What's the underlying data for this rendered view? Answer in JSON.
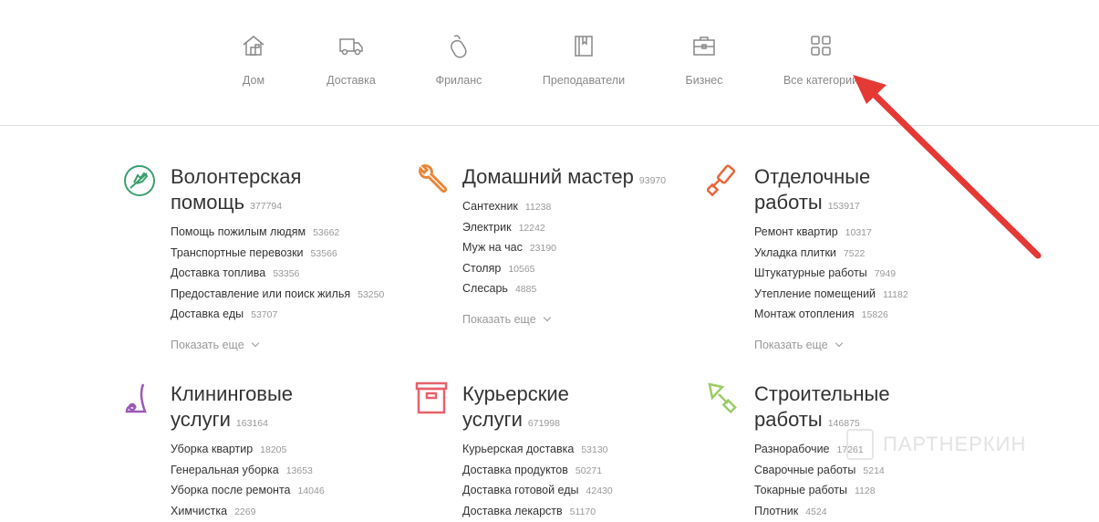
{
  "nav": [
    {
      "label": "Дом",
      "icon": "house-icon"
    },
    {
      "label": "Доставка",
      "icon": "truck-icon"
    },
    {
      "label": "Фриланс",
      "icon": "mouse-icon"
    },
    {
      "label": "Преподаватели",
      "icon": "book-icon"
    },
    {
      "label": "Бизнес",
      "icon": "briefcase-icon"
    },
    {
      "label": "Все категории",
      "icon": "grid-icon"
    }
  ],
  "more_label": "Показать еще",
  "watermark": "ПАРТНЕРКИН",
  "colors": {
    "green": "#3a9f6e",
    "orange": "#e8863a",
    "orange2": "#e8663a",
    "purple": "#9b59b6",
    "red": "#e8606a",
    "lime": "#9ccc65",
    "arrow": "#e53935"
  },
  "categories": [
    {
      "title1": "Волонтерская",
      "title2": "помощь",
      "count": "377794",
      "items": [
        [
          "Помощь пожилым людям",
          "53662"
        ],
        [
          "Транспортные перевозки",
          "53566"
        ],
        [
          "Доставка топлива",
          "53356"
        ],
        [
          "Предоставление или поиск жилья",
          "53250"
        ],
        [
          "Доставка еды",
          "53707"
        ]
      ]
    },
    {
      "title1": "Домашний мастер",
      "title2": "",
      "count": "93970",
      "items": [
        [
          "Сантехник",
          "11238"
        ],
        [
          "Электрик",
          "12242"
        ],
        [
          "Муж на час",
          "23190"
        ],
        [
          "Столяр",
          "10565"
        ],
        [
          "Слесарь",
          "4885"
        ]
      ]
    },
    {
      "title1": "Отделочные",
      "title2": "работы",
      "count": "153917",
      "items": [
        [
          "Ремонт квартир",
          "10317"
        ],
        [
          "Укладка плитки",
          "7522"
        ],
        [
          "Штукатурные работы",
          "7949"
        ],
        [
          "Утепление помещений",
          "11182"
        ],
        [
          "Монтаж отопления",
          "15826"
        ]
      ]
    },
    {
      "title1": "Клининговые",
      "title2": "услуги",
      "count": "163164",
      "items": [
        [
          "Уборка квартир",
          "18205"
        ],
        [
          "Генеральная уборка",
          "13653"
        ],
        [
          "Уборка после ремонта",
          "14046"
        ],
        [
          "Химчистка",
          "2269"
        ]
      ]
    },
    {
      "title1": "Курьерские",
      "title2": "услуги",
      "count": "671998",
      "items": [
        [
          "Курьерская доставка",
          "53130"
        ],
        [
          "Доставка продуктов",
          "50271"
        ],
        [
          "Доставка готовой еды",
          "42430"
        ],
        [
          "Доставка лекарств",
          "51170"
        ]
      ]
    },
    {
      "title1": "Строительные",
      "title2": "работы",
      "count": "146875",
      "items": [
        [
          "Разнорабочие",
          "17261"
        ],
        [
          "Сварочные работы",
          "5214"
        ],
        [
          "Токарные работы",
          "1128"
        ],
        [
          "Плотник",
          "4524"
        ]
      ]
    }
  ]
}
